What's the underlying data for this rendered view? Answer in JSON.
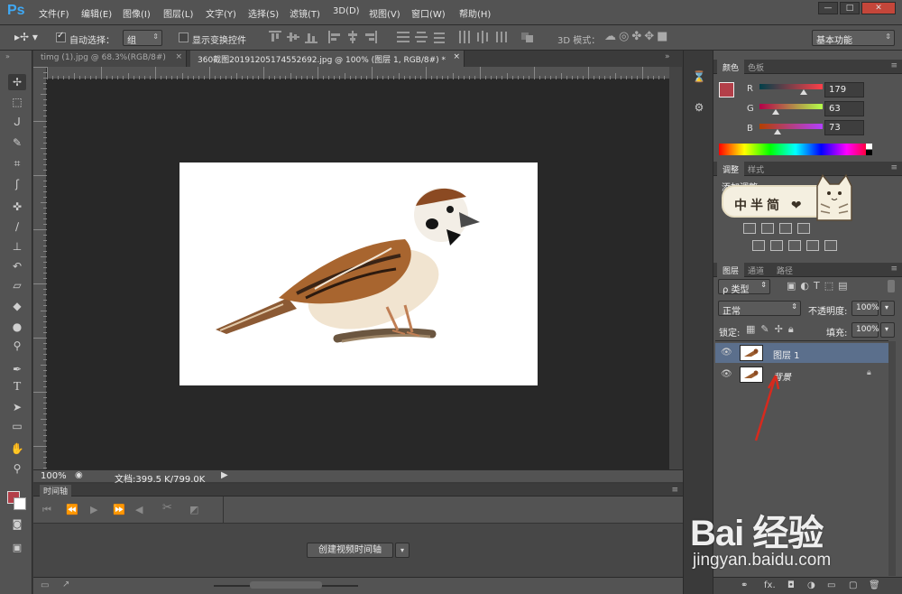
{
  "app": {
    "logo": "Ps"
  },
  "menu": [
    "文件(F)",
    "编辑(E)",
    "图像(I)",
    "图层(L)",
    "文字(Y)",
    "选择(S)",
    "滤镜(T)",
    "3D(D)",
    "视图(V)",
    "窗口(W)",
    "帮助(H)"
  ],
  "window_controls": {
    "minimize": "—",
    "maximize": "□",
    "close": "✕"
  },
  "options_bar": {
    "auto_select_label": "自动选择：",
    "auto_select_checked": true,
    "auto_select_value": "组",
    "show_transform_label": "显示变换控件",
    "mode_3d_label": "3D 模式：",
    "workspace": "基本功能"
  },
  "tabs": [
    {
      "label": "timg (1).jpg @ 68.3%(RGB/8#)",
      "close": "×",
      "active": false
    },
    {
      "label": "360截图20191205174552692.jpg @ 100% (图层 1, RGB/8#) *",
      "close": "×",
      "active": true
    }
  ],
  "status": {
    "zoom": "100%",
    "doc_info": "文档:399.5 K/799.0K"
  },
  "timeline": {
    "title": "时间轴",
    "create_button": "创建视频时间轴",
    "dropdown_arrow": "▾"
  },
  "color_panel": {
    "tabs": [
      "颜色",
      "色板"
    ],
    "channels": [
      {
        "name": "R",
        "value": "179",
        "fraction": 0.7
      },
      {
        "name": "G",
        "value": "63",
        "fraction": 0.25
      },
      {
        "name": "B",
        "value": "73",
        "fraction": 0.29
      }
    ],
    "foreground": "#b33f49",
    "background": "#ffffff"
  },
  "adjustments_panel": {
    "tabs": [
      "调整",
      "样式"
    ],
    "title": "添加调整"
  },
  "sticker": {
    "text": "中半简 ❤"
  },
  "layers_panel": {
    "tabs": [
      "图层",
      "通道",
      "路径"
    ],
    "filter": "ρ 类型",
    "blend_mode": "正常",
    "opacity_label": "不透明度:",
    "opacity_value": "100%",
    "lock_label": "锁定:",
    "fill_label": "填充:",
    "fill_value": "100%",
    "layers": [
      {
        "name": "图层 1",
        "selected": true,
        "locked": false
      },
      {
        "name": "背景",
        "selected": false,
        "locked": true
      }
    ],
    "footer_fx": "fx."
  },
  "watermark": {
    "brand": "Bai  经验",
    "url": "jingyan.baidu.com"
  }
}
